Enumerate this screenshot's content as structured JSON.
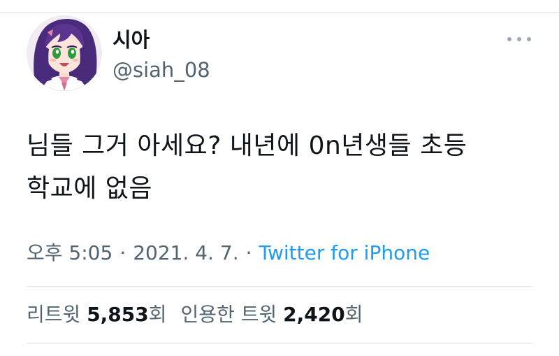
{
  "tweet": {
    "author": {
      "display_name": "시아",
      "handle": "@siah_08"
    },
    "text": "님들 그거 아세요? 내년에 0n년생들 초등학교에 없음",
    "text_line1": "님들 그거 아세요? 내년에 0n년생들 초등",
    "text_line2": "학교에 없음",
    "time": "오후 5:05",
    "separator": "·",
    "date": "2021. 4. 7.",
    "source": "Twitter for iPhone",
    "retweets": {
      "label": "리트윗",
      "count": "5,853",
      "unit": "회"
    },
    "quotes": {
      "label": "인용한 트윗",
      "count": "2,420",
      "unit": "회"
    }
  },
  "icons": {
    "more": "more-horizontal-icon",
    "avatar": "anime-girl-avatar"
  },
  "colors": {
    "text": "#0f1419",
    "secondary": "#536471",
    "link": "#1d9bf0"
  }
}
